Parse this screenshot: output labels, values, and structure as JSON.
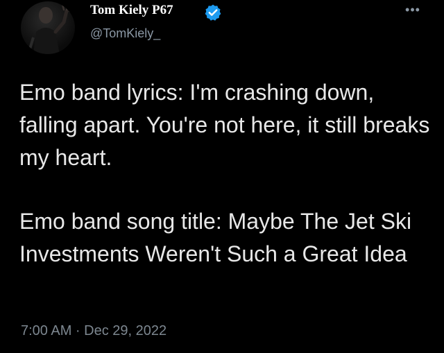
{
  "tweet": {
    "author": {
      "display_name": "Tom Kiely P67",
      "handle": "@TomKiely_",
      "verified_icon": "verified-badge-icon",
      "avatar": "profile-photo"
    },
    "more_icon": "more-options-icon",
    "paragraphs": [
      "Emo band lyrics: I'm crashing down, falling apart. You're not here, it still breaks my heart.",
      "Emo band song title: Maybe The Jet Ski Investments Weren't Such a Great Idea"
    ],
    "timestamp": "7:00 AM · Dec 29, 2022"
  },
  "colors": {
    "background": "#000000",
    "verified_blue": "#1d9bf0",
    "secondary_text": "#8b98a5"
  }
}
